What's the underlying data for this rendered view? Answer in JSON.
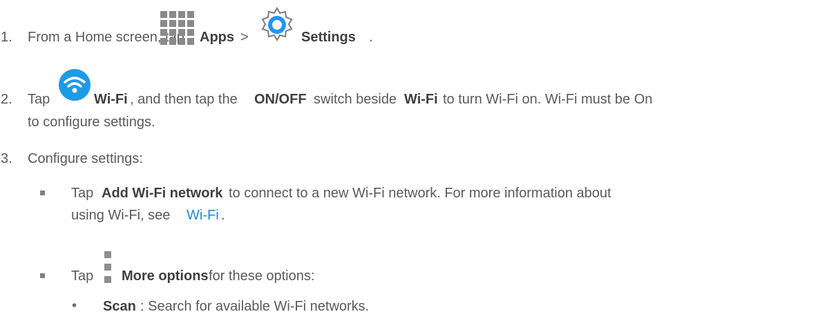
{
  "steps": [
    {
      "number": "1.",
      "pre": "From a Home screen, tap",
      "apps_label": "Apps",
      "sep": ">",
      "settings_label": "Settings",
      "end": "."
    },
    {
      "number": "2.",
      "pre": "Tap",
      "wifi_label": "Wi-Fi",
      "mid1": ", and then tap the",
      "onoff_label": "ON/OFF",
      "mid2": "switch beside",
      "wifi_label2": "Wi-Fi",
      "mid3": "to turn Wi-Fi on. Wi-Fi must be On",
      "line2": "to configure settings."
    },
    {
      "number": "3.",
      "text": "Configure settings:"
    }
  ],
  "bullets": [
    {
      "pre": "Tap",
      "bold": "Add Wi-Fi network",
      "post": "to connect to a new Wi-Fi network. For more information about",
      "line2_pre": "using Wi-Fi, see",
      "link": "Wi-Fi",
      "line2_post": "."
    },
    {
      "pre": "Tap",
      "bold": "More options",
      "post": "for these options:"
    }
  ],
  "sub_bullets": [
    {
      "symbol": "•",
      "bold": "Scan",
      "post": ": Search for available Wi-Fi networks."
    }
  ],
  "icons": {
    "apps": "apps-grid-icon",
    "settings": "settings-gear-icon",
    "wifi": "wifi-icon",
    "more": "more-options-icon"
  },
  "colors": {
    "text": "#5a5a5a",
    "bold": "#3f3f3f",
    "link": "#1a8fc9",
    "wifi_blue": "#1e9be6",
    "gear_blue": "#2196f3"
  }
}
